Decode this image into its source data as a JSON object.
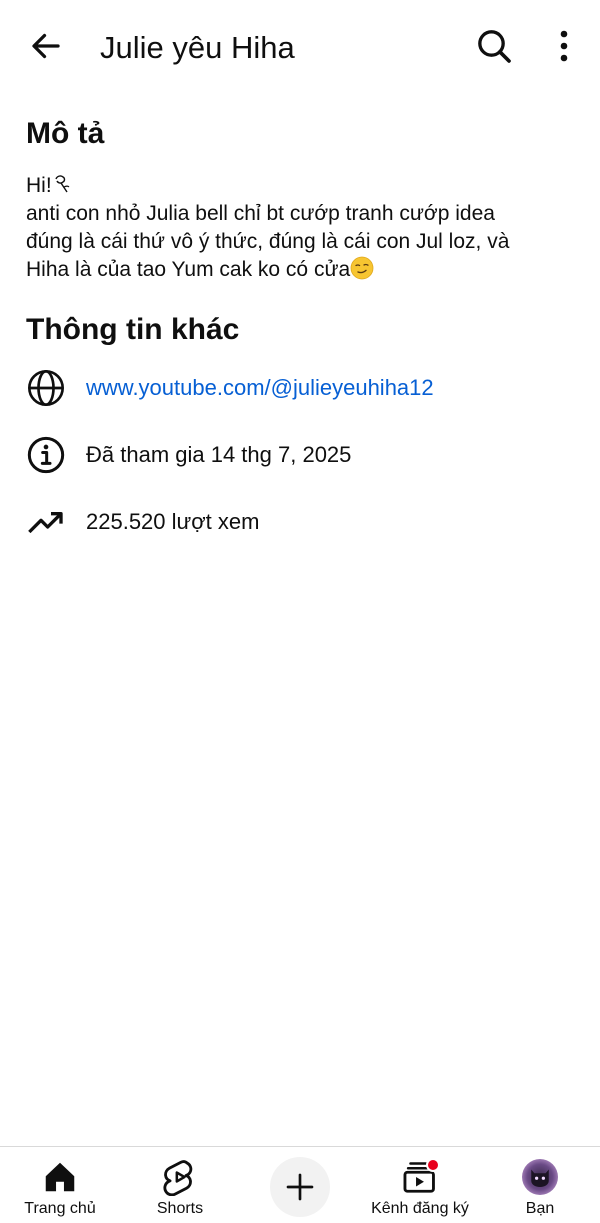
{
  "header": {
    "title": "Julie yêu Hiha",
    "back_icon": "arrow-left-icon",
    "search_icon": "search-icon",
    "more_icon": "more-vertical-icon"
  },
  "description": {
    "heading": "Mô tả",
    "lines": [
      "Hi!",
      "anti con nhỏ Julia bell chỉ bt cướp tranh cướp idea",
      "đúng là cái thứ vô ý thức, đúng là cái con Jul loz, và",
      "Hiha là của tao Yum cak ko có cửa"
    ],
    "line1_emoji": "rose-emoji",
    "line4_emoji": "smirking-face-emoji"
  },
  "other_info": {
    "heading": "Thông tin khác",
    "link": {
      "icon": "globe-icon",
      "text": "www.youtube.com/@julieyeuhiha12"
    },
    "joined": {
      "icon": "info-icon",
      "text": "Đã tham gia 14 thg 7, 2025"
    },
    "views": {
      "icon": "trending-up-icon",
      "text": "225.520 lượt xem"
    }
  },
  "bottom_nav": {
    "home": {
      "label": "Trang chủ",
      "icon": "home-icon"
    },
    "shorts": {
      "label": "Shorts",
      "icon": "shorts-icon"
    },
    "create": {
      "icon": "plus-icon"
    },
    "subscriptions": {
      "label": "Kênh đăng ký",
      "icon": "subscriptions-icon",
      "has_notification_dot": true
    },
    "you": {
      "label": "Bạn",
      "icon": "avatar"
    }
  },
  "colors": {
    "link": "#065fd4",
    "notification_dot": "#e8001c",
    "text": "#0f0f0f"
  }
}
